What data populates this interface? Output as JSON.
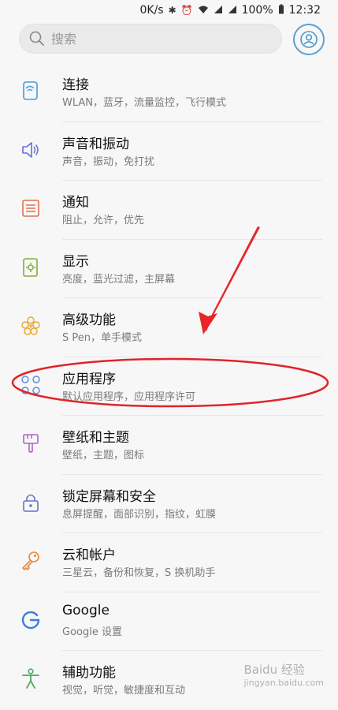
{
  "status_bar": {
    "network_speed": "0K/s",
    "battery": "100%",
    "time": "12:32"
  },
  "search": {
    "placeholder": "搜索"
  },
  "menu_items": [
    {
      "title": "连接",
      "subtitle": "WLAN，蓝牙，流量监控，飞行模式",
      "icon": "connections-icon"
    },
    {
      "title": "声音和振动",
      "subtitle": "声音，振动，免打扰",
      "icon": "sound-icon"
    },
    {
      "title": "通知",
      "subtitle": "阻止，允许，优先",
      "icon": "notifications-icon"
    },
    {
      "title": "显示",
      "subtitle": "亮度，蓝光过滤，主屏幕",
      "icon": "display-icon"
    },
    {
      "title": "高级功能",
      "subtitle": "S Pen，单手模式",
      "icon": "advanced-features-icon"
    },
    {
      "title": "应用程序",
      "subtitle": "默认应用程序，应用程序许可",
      "icon": "apps-icon"
    },
    {
      "title": "壁纸和主题",
      "subtitle": "壁纸，主题，图标",
      "icon": "wallpaper-icon"
    },
    {
      "title": "锁定屏幕和安全",
      "subtitle": "息屏提醒，面部识别，指纹，虹膜",
      "icon": "lock-icon"
    },
    {
      "title": "云和帐户",
      "subtitle": "三星云，备份和恢复，S 换机助手",
      "icon": "key-icon"
    },
    {
      "title": "Google",
      "subtitle": "Google 设置",
      "icon": "google-icon"
    },
    {
      "title": "辅助功能",
      "subtitle": "视觉，听觉，敏捷度和互动",
      "icon": "accessibility-icon"
    }
  ],
  "annotation_colors": {
    "arrow": "#e8262a",
    "ellipse": "#e0242a"
  },
  "watermark": {
    "brand": "Baidu 经验",
    "url": "jingyan.baidu.com"
  }
}
